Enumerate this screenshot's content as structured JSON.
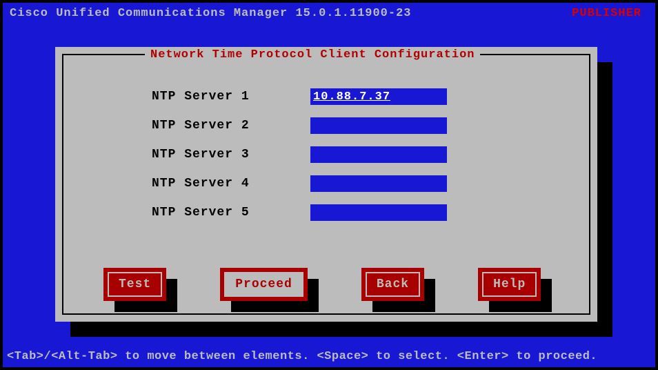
{
  "header": {
    "title": "Cisco Unified Communications Manager 15.0.1.11900-23",
    "role": "PUBLISHER"
  },
  "dialog": {
    "title": "Network Time Protocol Client Configuration"
  },
  "fields": [
    {
      "label": "NTP Server 1",
      "value": "10.88.7.37"
    },
    {
      "label": "NTP Server 2",
      "value": ""
    },
    {
      "label": "NTP Server 3",
      "value": ""
    },
    {
      "label": "NTP Server 4",
      "value": ""
    },
    {
      "label": "NTP Server 5",
      "value": ""
    }
  ],
  "buttons": {
    "test": "Test",
    "proceed": "Proceed",
    "back": "Back",
    "help": "Help"
  },
  "hint": "<Tab>/<Alt-Tab> to move between elements. <Space> to select. <Enter> to proceed."
}
